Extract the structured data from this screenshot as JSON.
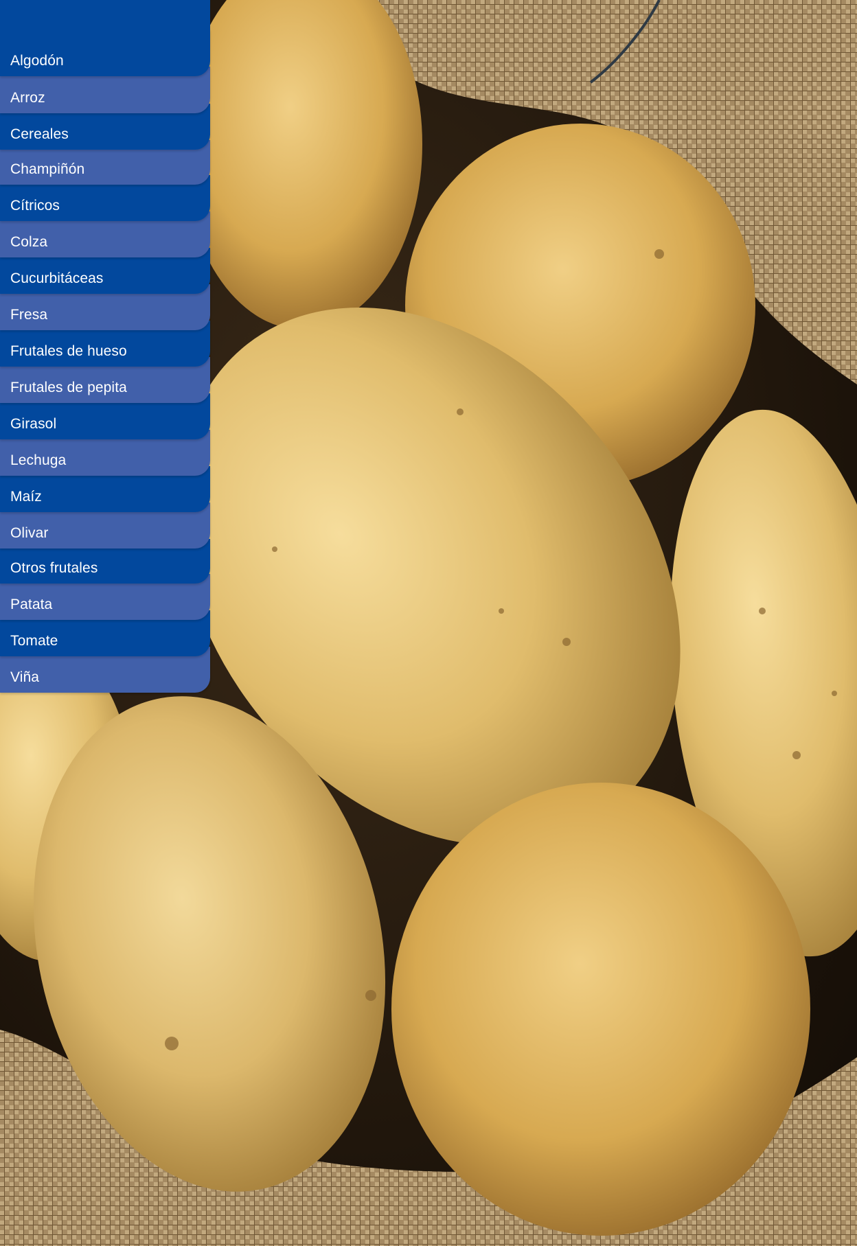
{
  "colors": {
    "menu_dark": "#02489d",
    "menu_light": "#4160aa",
    "menu_text": "#ffffff"
  },
  "crop_menu": {
    "items": [
      {
        "label": "Algodón"
      },
      {
        "label": "Arroz"
      },
      {
        "label": "Cereales"
      },
      {
        "label": "Champiñón"
      },
      {
        "label": "Cítricos"
      },
      {
        "label": "Colza"
      },
      {
        "label": "Cucurbitáceas"
      },
      {
        "label": "Fresa"
      },
      {
        "label": "Frutales de hueso"
      },
      {
        "label": "Frutales de pepita"
      },
      {
        "label": "Girasol"
      },
      {
        "label": "Lechuga"
      },
      {
        "label": "Maíz"
      },
      {
        "label": "Olivar"
      },
      {
        "label": "Otros frutales"
      },
      {
        "label": "Patata"
      },
      {
        "label": "Tomate"
      },
      {
        "label": "Viña"
      }
    ]
  }
}
